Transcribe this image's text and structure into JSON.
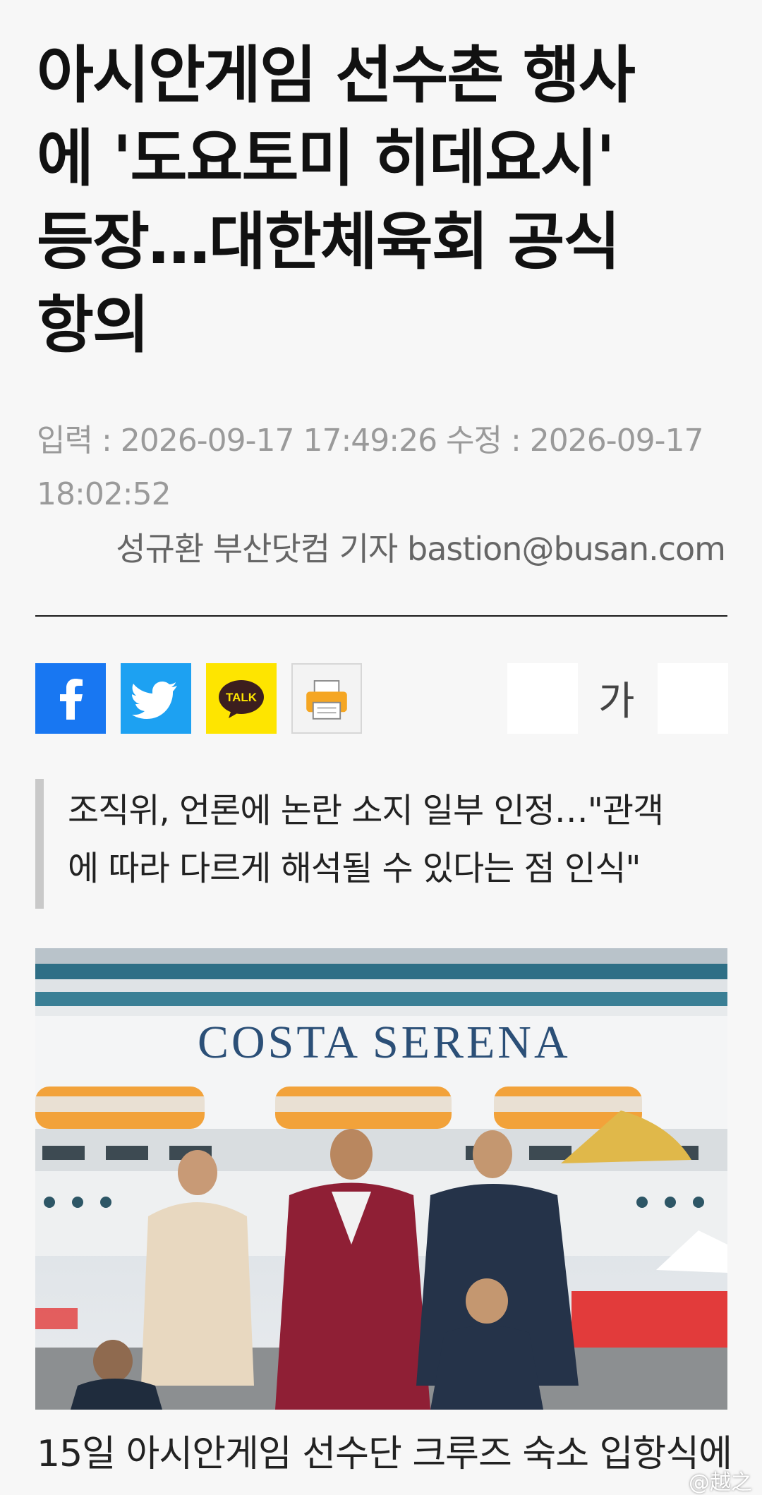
{
  "article": {
    "headline_lines": [
      "아시안게임 선수촌 행사",
      "에 '도요토미 히데요시'",
      "등장…대한체육회 공식",
      "항의"
    ],
    "meta_line1": "입력 : 2026-09-17 17:49:26 수정 : 2026-09-17",
    "meta_line2": "18:02:52",
    "byline": "성규환 부산닷컴 기자 bastion@busan.com",
    "summary_line1": "조직위, 언론에 논란 소지 일부 인정…\"관객",
    "summary_line2": "에 따라 다르게 해석될 수 있다는 점 인식\"",
    "caption": "15일 아시안게임 선수단 크루즈 숙소 입항식에"
  },
  "share": {
    "facebook_icon": "facebook-icon",
    "twitter_icon": "twitter-icon",
    "kakao_label": "TALK",
    "print_icon": "printer-icon"
  },
  "font_controls": {
    "label": "가"
  },
  "photo": {
    "ship_name": "COSTA SERENA"
  },
  "watermark": "@越之",
  "colors": {
    "facebook": "#1877f2",
    "twitter": "#1da1f2",
    "kakao": "#fee500",
    "background": "#f7f7f7"
  }
}
